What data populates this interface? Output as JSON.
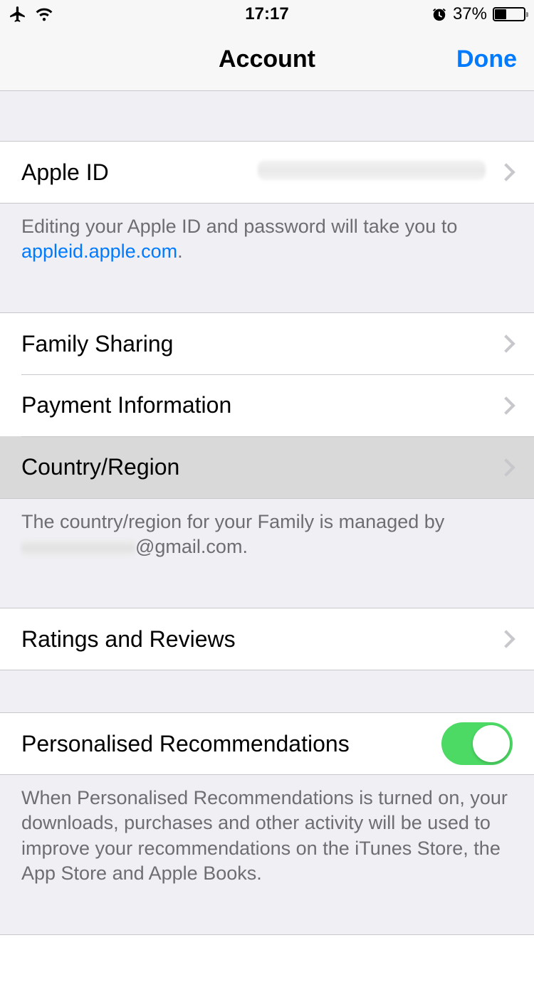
{
  "status": {
    "time": "17:17",
    "battery_pct": "37%"
  },
  "nav": {
    "title": "Account",
    "done": "Done"
  },
  "apple_id": {
    "label": "Apple ID"
  },
  "apple_id_footer": {
    "text_prefix": "Editing your Apple ID and password will take you to ",
    "link": "appleid.apple.com",
    "suffix": "."
  },
  "rows": {
    "family_sharing": "Family Sharing",
    "payment_info": "Payment Information",
    "country_region": "Country/Region"
  },
  "country_footer": {
    "prefix": "The country/region for your Family is managed by ",
    "suffix": "@gmail.com."
  },
  "ratings": {
    "label": "Ratings and Reviews"
  },
  "personalised": {
    "label": "Personalised Recommendations",
    "on": true
  },
  "personalised_footer": "When Personalised Recommendations is turned on, your downloads, purchases and other activity will be used to improve your recommendations on the iTunes Store, the App Store and Apple Books."
}
